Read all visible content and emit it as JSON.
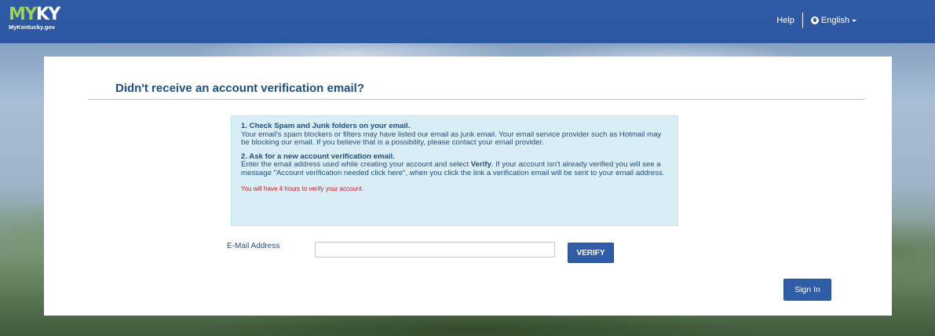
{
  "header": {
    "logo_my": "MY",
    "logo_ky": "KY",
    "logo_sub": "MyKentucky.gov",
    "help_label": "Help",
    "language_label": "English"
  },
  "main": {
    "title": "Didn't receive an account verification email?",
    "step1": {
      "heading": "1. Check Spam and Junk folders on your email.",
      "body": "Your email's spam blockers or filters may have listed our email as junk email. Your email service provider such as Hotmail may be blocking our email. If you believe that is a possibility, please contact your email provider."
    },
    "step2": {
      "heading": "2. Ask for a new account verification email.",
      "body_before": "Enter the email address used while creating your account and select ",
      "body_bold": "Verify",
      "body_after": ". If your account isn't already verified you will see a message \"Account verification needed click here\", when you click the link a verification email will be sent to your email address."
    },
    "warning": "You will have 4 hours to verify your account.",
    "email_label": "E-Mail Address",
    "email_value": "",
    "verify_label": "VERIFY",
    "signin_label": "Sign In"
  },
  "colors": {
    "brand_blue": "#2e5aa6",
    "logo_green": "#9bd15a",
    "info_bg": "#d9edf7",
    "warning_red": "#d9121b"
  },
  "icons": {
    "language": "globe-icon",
    "dropdown": "caret-down-icon"
  }
}
